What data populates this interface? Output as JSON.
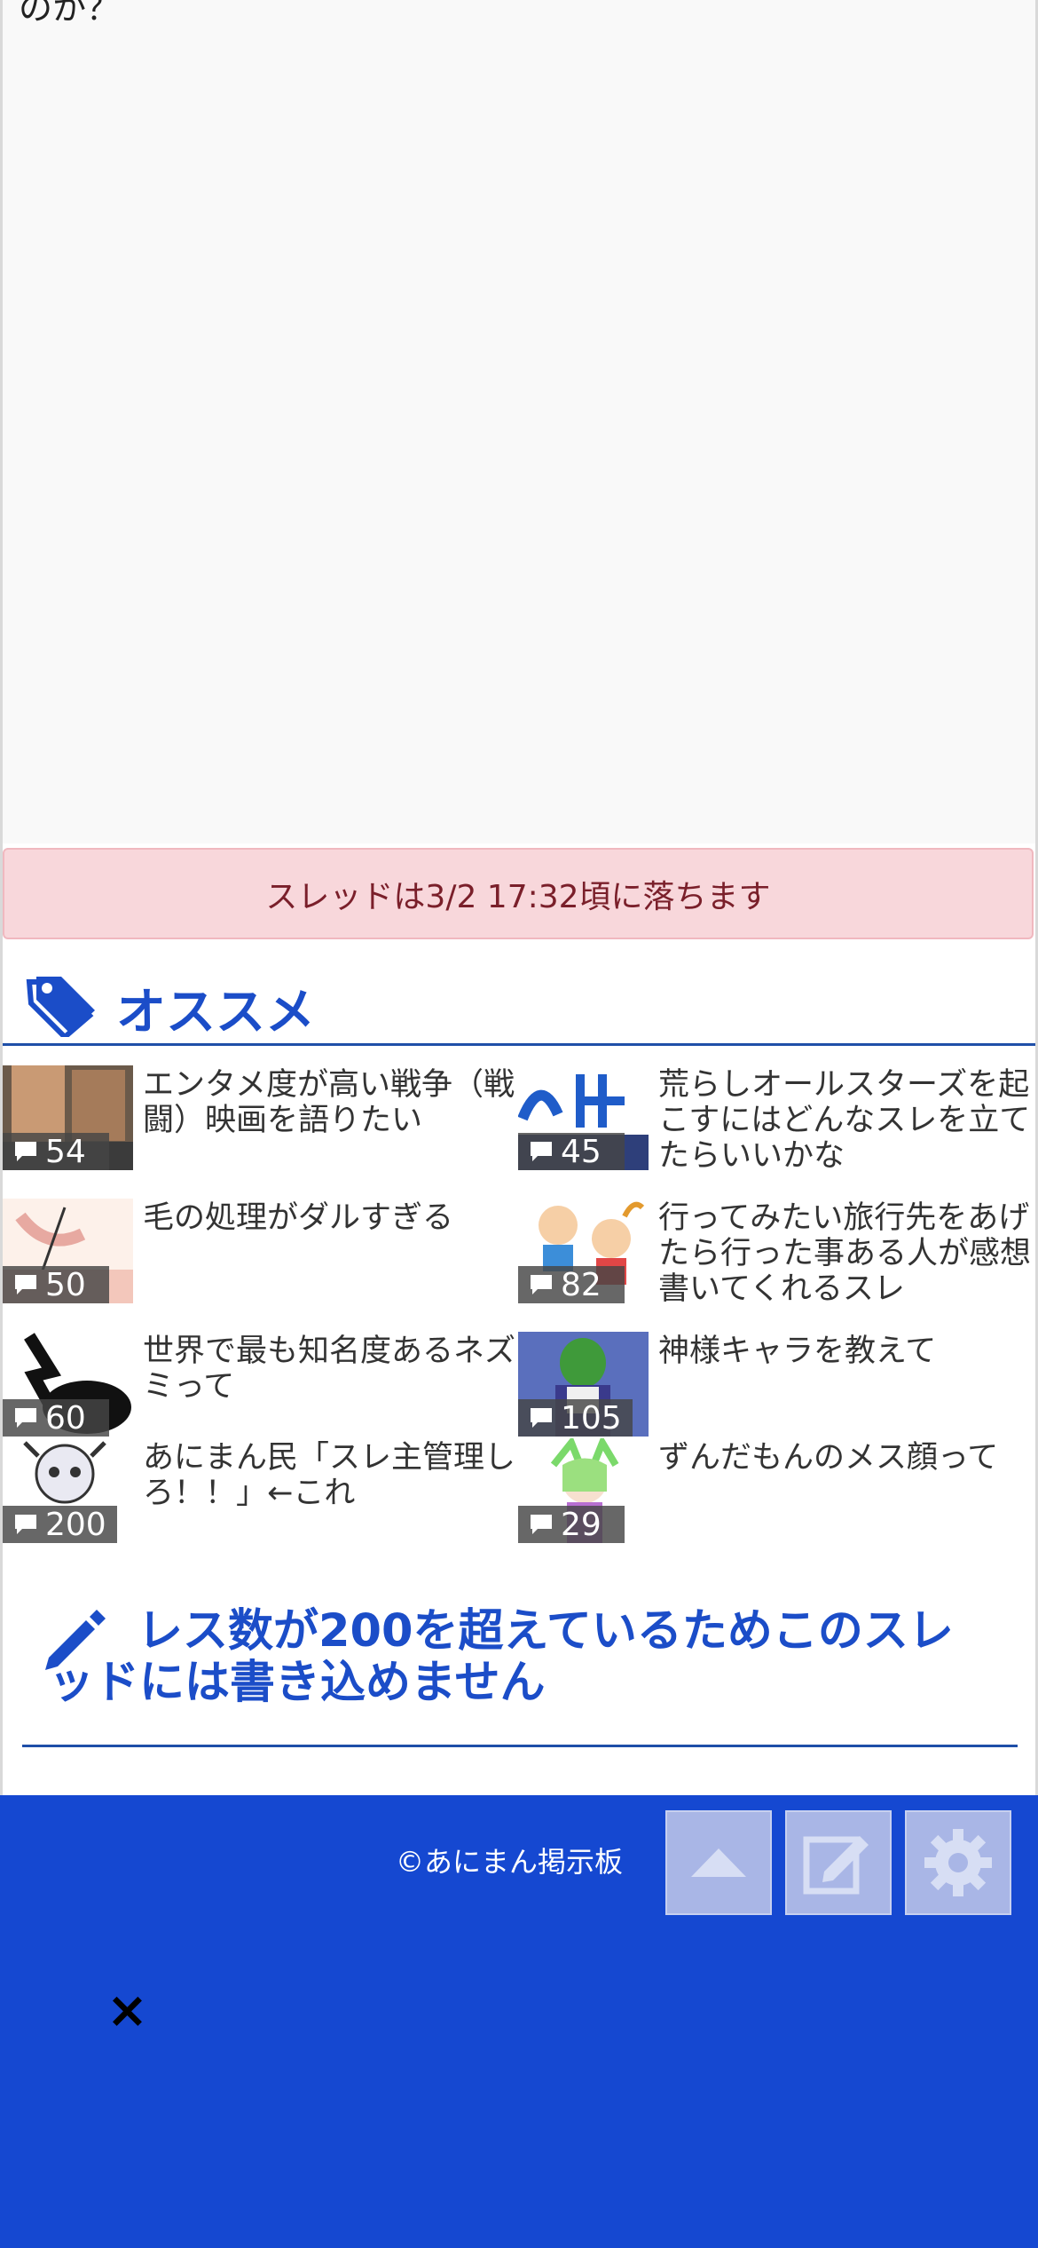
{
  "top": {
    "text_fragment": "のか？"
  },
  "notice": {
    "text": "スレッドは3/2 17:32頃に落ちます"
  },
  "recommend": {
    "title": "オススメ",
    "items": [
      {
        "title": "エンタメ度が高い戦争（戦闘）映画を語りたい",
        "count": "54"
      },
      {
        "title": "荒らしオールスターズを起こすにはどんなスレを立てたらいいかな",
        "count": "45"
      },
      {
        "title": "毛の処理がダルすぎる",
        "count": "50"
      },
      {
        "title": "行ってみたい旅行先をあげたら行った事ある人が感想書いてくれるスレ",
        "count": "82"
      },
      {
        "title": "世界で最も知名度あるネズミって",
        "count": "60"
      },
      {
        "title": "神様キャラを教えて",
        "count": "105"
      },
      {
        "title": "あにまん民「スレ主管理しろ！！」←これ",
        "count": "200"
      },
      {
        "title": "ずんだもんのメス顔って",
        "count": "29"
      }
    ]
  },
  "write": {
    "message": "レス数が200を超えているためこのスレッドには書き込めません"
  },
  "footer": {
    "copyright": "©あにまん掲示板",
    "close": "×",
    "accent": "#1548d1"
  }
}
